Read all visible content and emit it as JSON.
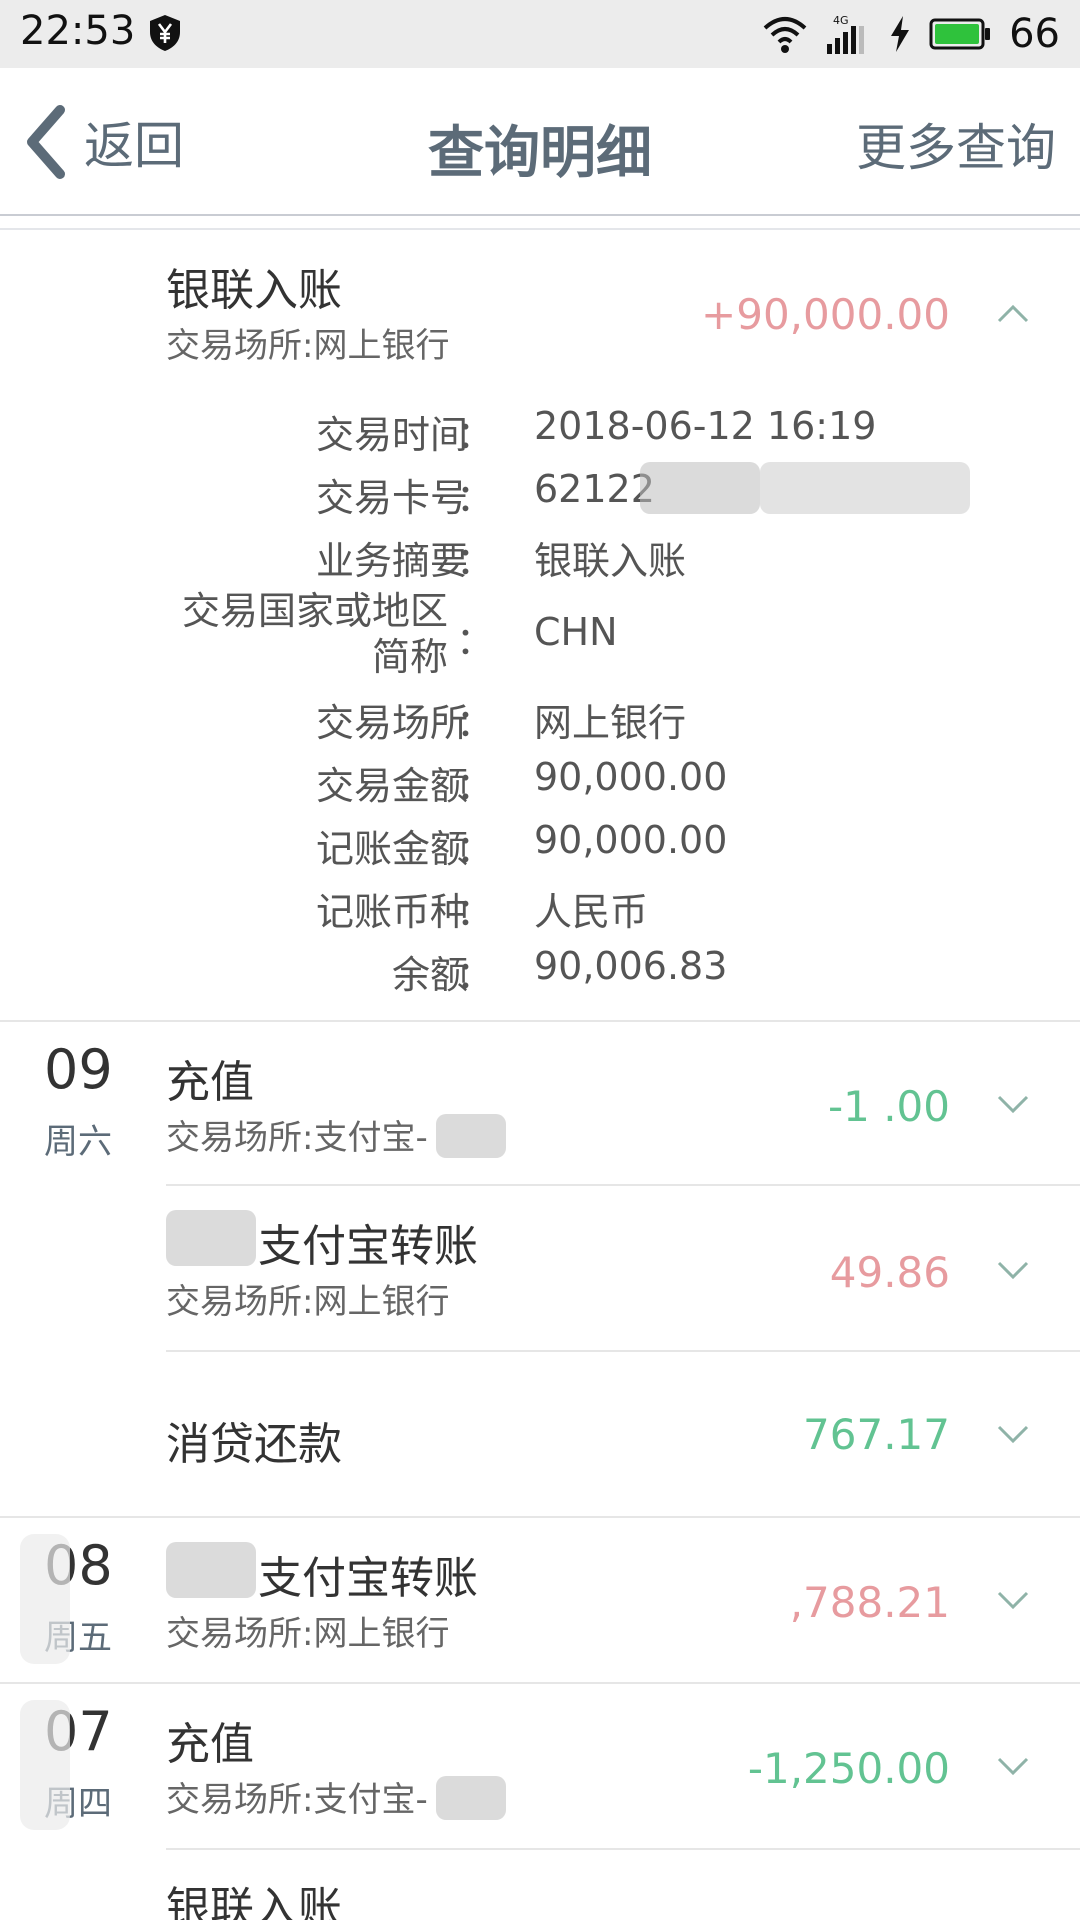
{
  "status_bar": {
    "time": "22:53",
    "network": "4G",
    "battery_level": "66",
    "icons": [
      "shield-yen-icon",
      "wifi-icon",
      "signal-icon",
      "charging-icon",
      "battery-icon"
    ]
  },
  "nav": {
    "back_label": "返回",
    "title": "查询明细",
    "more_label": "更多查询"
  },
  "colors": {
    "positive_amount": "#e79b9f",
    "negative_amount": "#62c392",
    "nav_text": "#5c6b78"
  },
  "expanded_transaction": {
    "title": "银联入账",
    "subtitle": "交易场所:网上银行",
    "amount": "+90,000.00",
    "details": [
      {
        "label": "交易时间",
        "value": "2018-06-12 16:19"
      },
      {
        "label": "交易卡号",
        "value": "62122"
      },
      {
        "label": "业务摘要",
        "value": "银联入账"
      },
      {
        "label": "交易国家或地区简称",
        "value": "CHN"
      },
      {
        "label": "交易场所",
        "value": "网上银行"
      },
      {
        "label": "交易金额",
        "value": "90,000.00"
      },
      {
        "label": "记账金额",
        "value": "90,000.00"
      },
      {
        "label": "记账币种",
        "value": "人民币"
      },
      {
        "label": "余额",
        "value": "90,006.83"
      }
    ],
    "colon": "："
  },
  "groups": [
    {
      "day": "09",
      "weekday": "周六",
      "transactions": [
        {
          "title": "充值",
          "subtitle": "交易场所:支付宝-",
          "amount": "-1 .00"
        },
        {
          "title": "支付宝转账",
          "subtitle": "交易场所:网上银行",
          "amount": "49.86"
        },
        {
          "title": "消贷还款",
          "subtitle": "",
          "amount": "767.17"
        }
      ]
    },
    {
      "day": "08",
      "weekday": "周五",
      "transactions": [
        {
          "title": "支付宝转账",
          "subtitle": "交易场所:网上银行",
          "amount": ",788.21"
        }
      ]
    },
    {
      "day": "07",
      "weekday": "周四",
      "transactions": [
        {
          "title": "充值",
          "subtitle": "交易场所:支付宝-",
          "amount": "-1,250.00"
        },
        {
          "title": "银联入账",
          "subtitle": "",
          "amount": ""
        }
      ]
    }
  ]
}
